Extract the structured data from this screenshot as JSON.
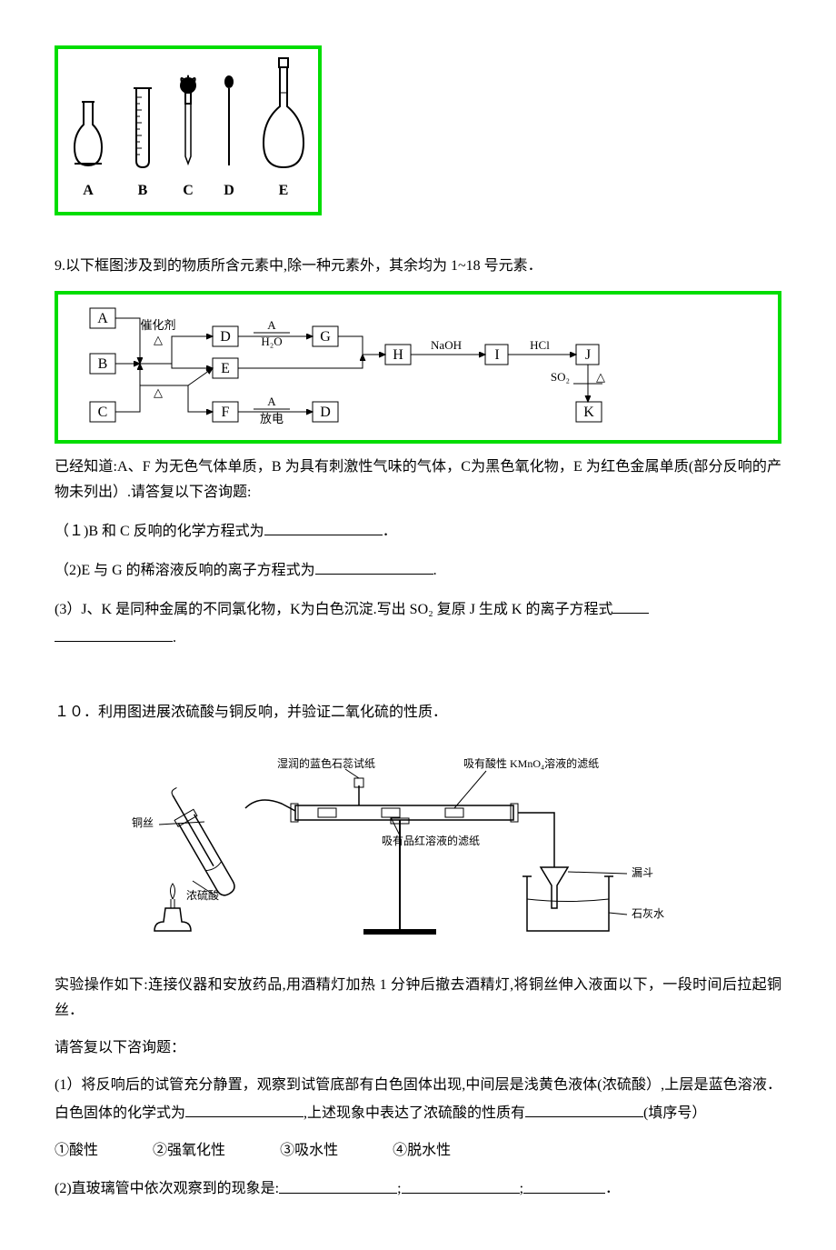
{
  "apparatus": {
    "labels": [
      "A",
      "B",
      "C",
      "D",
      "E"
    ]
  },
  "q9": {
    "number": "9.",
    "intro": "以下框图涉及到的物质所含元素中,除一种元素外，其余均为 1~18 号元素．",
    "flow": {
      "boxes": [
        "A",
        "B",
        "C",
        "D",
        "E",
        "F",
        "G",
        "H",
        "I",
        "J",
        "K"
      ],
      "labels": {
        "cat": "催化剂",
        "delta1": "△",
        "delta2": "△",
        "h2o": "H₂O",
        "a_over": "A",
        "discharge": "放电",
        "naoh": "NaOH",
        "hcl": "HCl",
        "so2": "SO₂",
        "delta3": "△"
      }
    },
    "known": "已经知道:A、F 为无色气体单质，B 为具有刺激性气味的气体，C为黑色氧化物，E 为红色金属单质(部分反响的产物未列出）.请答复以下咨询题:",
    "p1": "（１)B 和 C 反响的化学方程式为",
    "p1_end": "．",
    "p2": "（2)E 与 G 的稀溶液反响的离子方程式为",
    "p2_end": ".",
    "p3_a": "(3）J、K 是同种金属的不同氯化物，K为白色沉淀.写出 SO₂ 复原 J 生成 K 的离子方程式",
    "p3_end": "."
  },
  "q10": {
    "number": "１０．",
    "intro": "利用图进展浓硫酸与铜反响，并验证二氧化硫的性质．",
    "diagram_labels": {
      "wet_litmus": "湿润的蓝色石蕊试纸",
      "kmno4": "吸有酸性 KMnO₄溶液的滤纸",
      "cu_wire": "铜丝",
      "pinhong": "吸有品红溶液的滤纸",
      "conc_h2so4": "浓硫酸",
      "funnel": "漏斗",
      "limewater": "石灰水"
    },
    "operation": "实验操作如下:连接仪器和安放药品,用酒精灯加热 1 分钟后撤去酒精灯,将铜丝伸入液面以下，一段时间后拉起铜丝．",
    "answer_prompt": "请答复以下咨询题：",
    "p1_a": "(1）将反响后的试管充分静置，观察到试管底部有白色固体出现,中间层是浅黄色液体(浓硫酸）,上层是蓝色溶液．白色固体的化学式为",
    "p1_b": ",上述现象中表达了浓硫酸的性质有",
    "p1_c": "(填序号）",
    "options": {
      "o1": "酸性",
      "o2": "强氧化性",
      "o3": "吸水性",
      "o4": "脱水性",
      "n1": "①",
      "n2": "②",
      "n3": "③",
      "n4": "④"
    },
    "p2_a": "(2)直玻璃管中依次观察到的现象是:",
    "p2_sep": ";",
    "p2_end": "．"
  }
}
